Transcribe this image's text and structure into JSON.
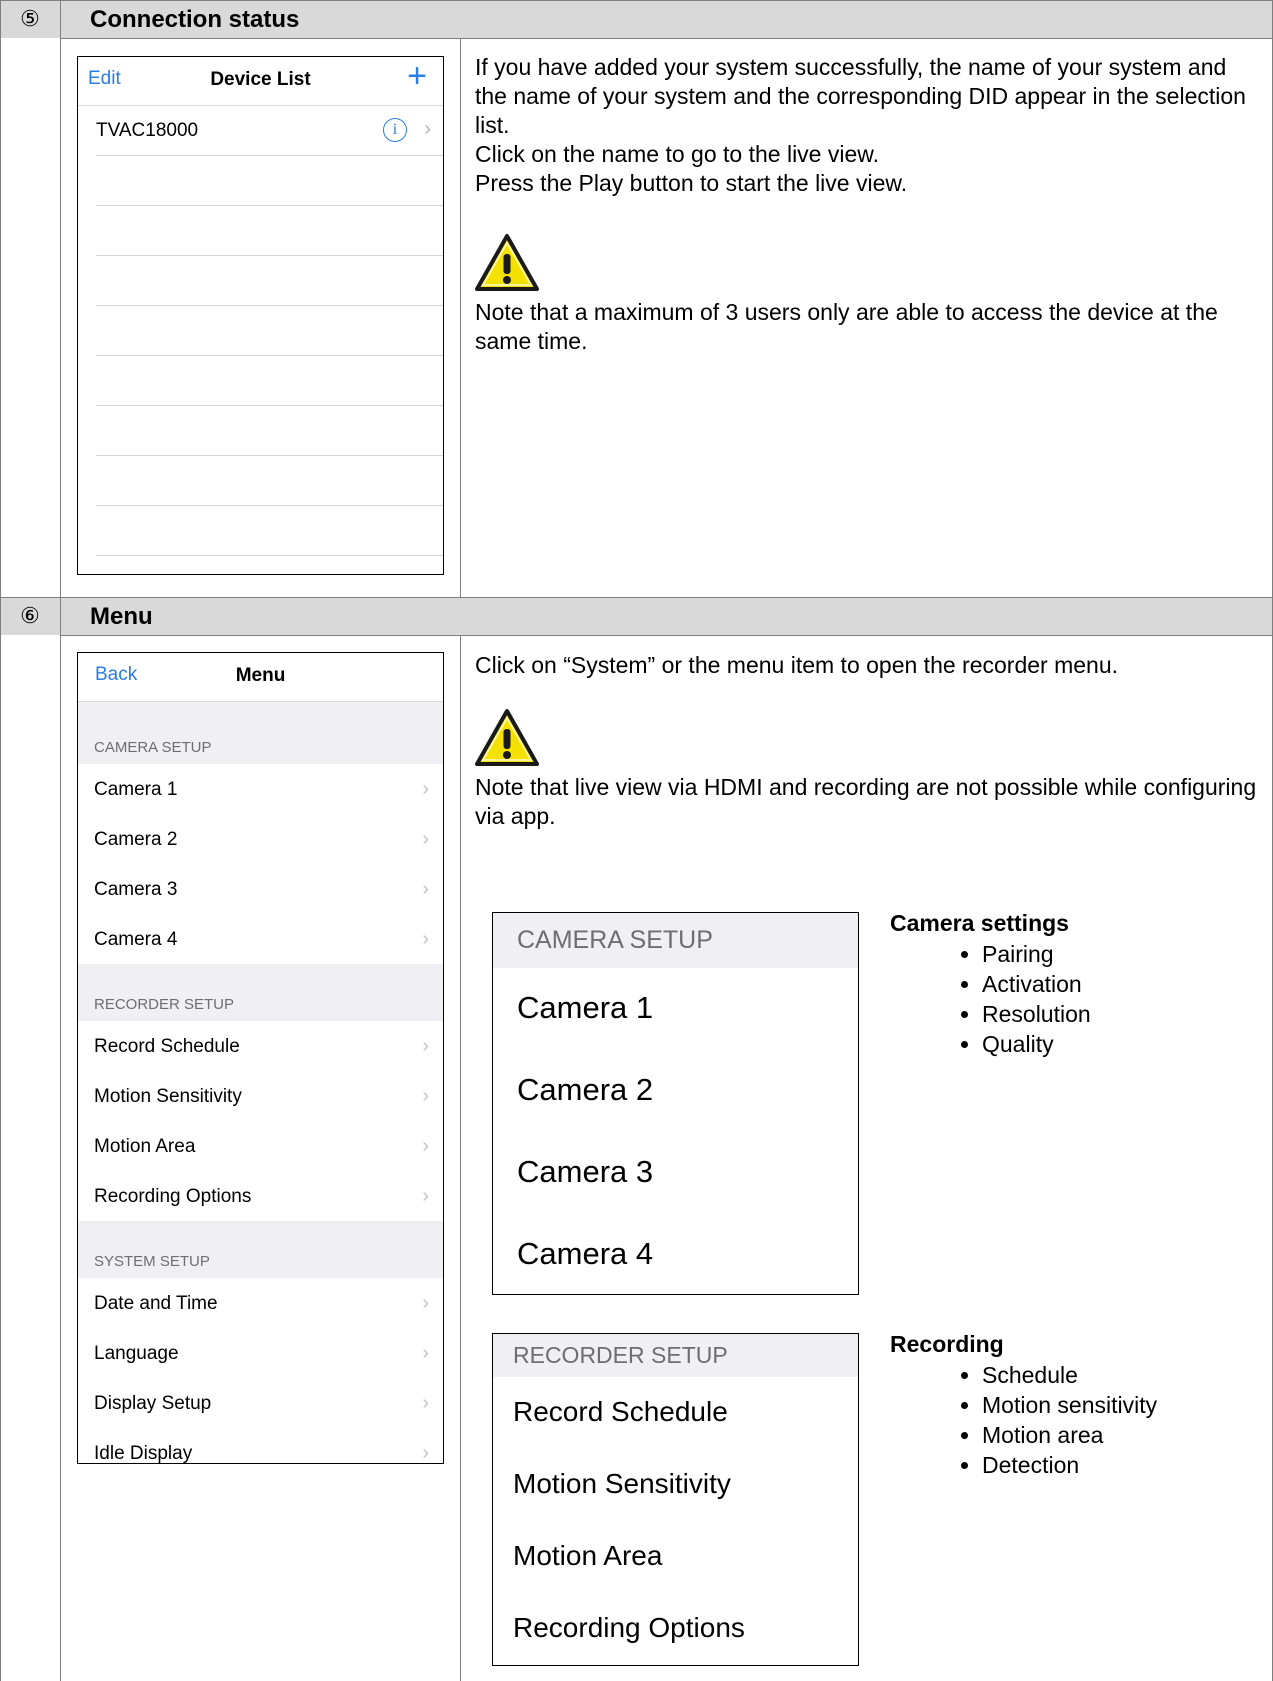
{
  "sections": [
    {
      "number": "⑤",
      "title": "Connection status"
    },
    {
      "number": "⑥",
      "title": "Menu"
    }
  ],
  "device_list": {
    "left_button": "Edit",
    "title": "Device List",
    "add_button": "+",
    "items": [
      "TVAC18000"
    ]
  },
  "connection_text": {
    "p1": "If you have added your system successfully, the name of your system and the name of your system and the corresponding DID appear in the selection list.",
    "p2": "Click on the name to go to the live view.",
    "p3": "Press the Play button to start the live view.",
    "note": "Note that a maximum of 3 users only are able to access the device at the same time."
  },
  "menu_screen": {
    "back_button": "Back",
    "title": "Menu",
    "groups": [
      {
        "header": "CAMERA SETUP",
        "items": [
          "Camera 1",
          "Camera 2",
          "Camera 3",
          "Camera 4"
        ]
      },
      {
        "header": "RECORDER SETUP",
        "items": [
          "Record Schedule",
          "Motion Sensitivity",
          "Motion Area",
          "Recording Options"
        ]
      },
      {
        "header": "SYSTEM SETUP",
        "items": [
          "Date and Time",
          "Language",
          "Display Setup",
          "Idle Display"
        ]
      }
    ]
  },
  "menu_text": {
    "p1": "Click on “System” or the menu item to open the recorder menu.",
    "note": "Note that live view via HDMI and recording are not possible while configuring via app."
  },
  "camera_zoom": {
    "header": "CAMERA SETUP",
    "items": [
      "Camera 1",
      "Camera 2",
      "Camera 3",
      "Camera 4"
    ]
  },
  "recorder_zoom": {
    "header": "RECORDER SETUP",
    "items": [
      "Record Schedule",
      "Motion Sensitivity",
      "Motion Area",
      "Recording Options"
    ]
  },
  "camera_settings": {
    "title": "Camera settings",
    "items": [
      "Pairing",
      "Activation",
      "Resolution",
      "Quality"
    ]
  },
  "recording": {
    "title": "Recording",
    "items": [
      "Schedule",
      "Motion sensitivity",
      "Motion area",
      "Detection"
    ]
  },
  "colors": {
    "accent": "#2b7de1",
    "header_bg": "#d9d9d9",
    "group_bg": "#efeff4",
    "warning": "#f5e100"
  }
}
